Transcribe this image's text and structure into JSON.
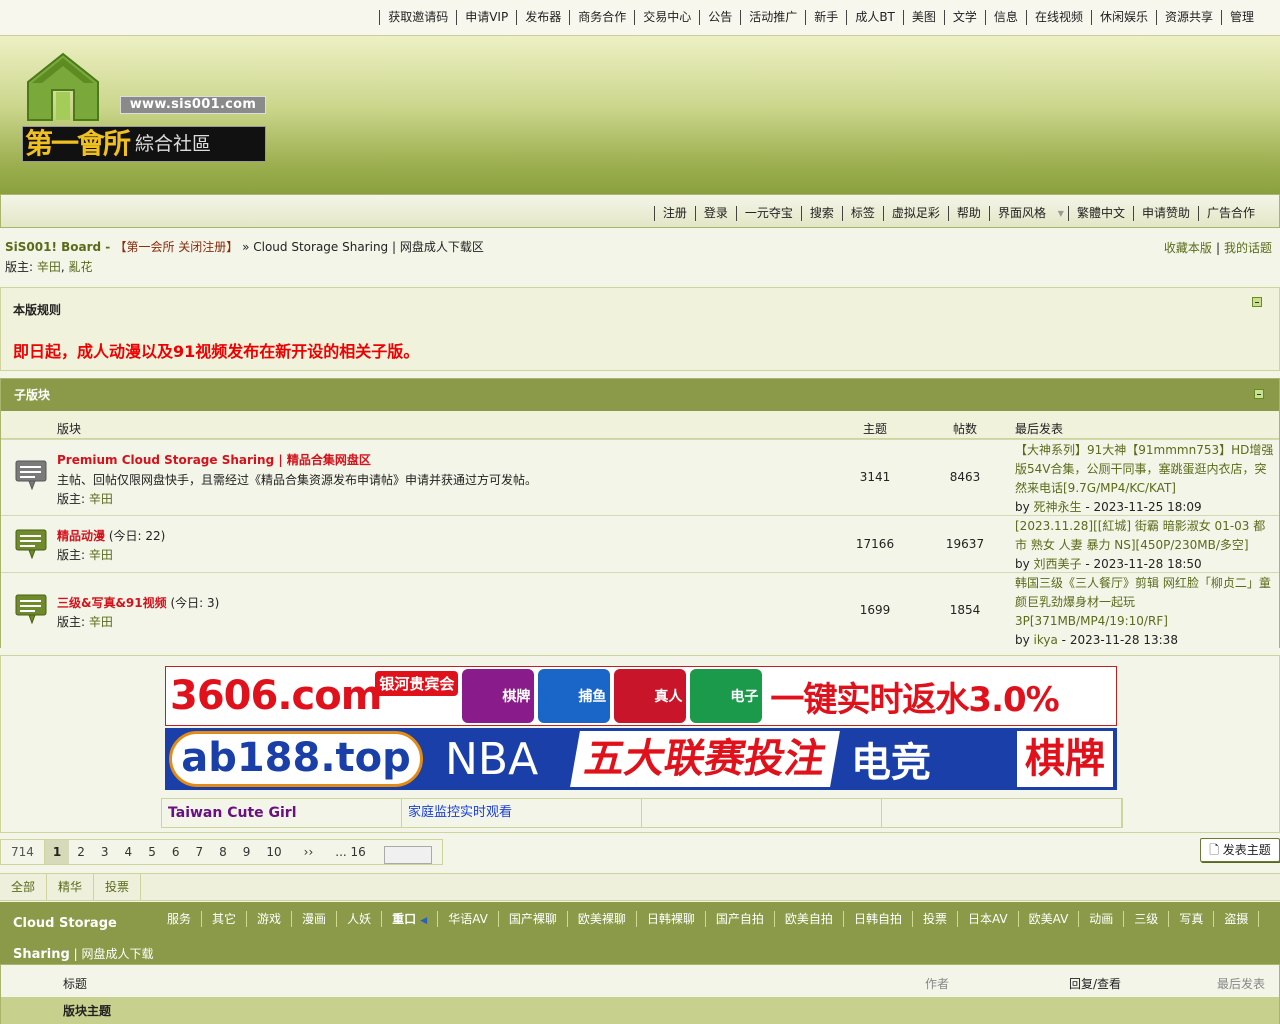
{
  "topbar": {
    "links": [
      "获取邀请码",
      "申请VIP",
      "发布器",
      "商务合作",
      "交易中心",
      "公告",
      "活动推广",
      "新手",
      "成人BT",
      "美图",
      "文学",
      "信息",
      "在线视频",
      "休闲娱乐",
      "资源共享",
      "管理"
    ]
  },
  "logo": {
    "url_text": "www.sis001.com",
    "big_text": "第一會所",
    "small_text": "綜合社區"
  },
  "nav": {
    "links": [
      "注册",
      "登录",
      "一元夺宝",
      "搜索",
      "标签",
      "虚拟足彩",
      "帮助",
      "界面风格",
      "繁體中文",
      "申请赞助",
      "广告合作"
    ]
  },
  "breadcrumb": {
    "site": "SiS001! Board",
    "sep1": " - ",
    "section": "【第一会所 关闭注册】",
    "sep2": " » ",
    "current": "Cloud Storage Sharing | 网盘成人下载区",
    "moderators_label": "版主: ",
    "moderators": [
      "辛田",
      "亂花"
    ],
    "favorite": "收藏本版",
    "my_threads": "我的话题"
  },
  "rules": {
    "title": "本版规则",
    "body": "即日起，成人动漫以及91视频发布在新开设的相关子版。"
  },
  "subforums": {
    "title": "子版块",
    "col_forum": "版块",
    "col_topics": "主题",
    "col_posts": "帖数",
    "col_last": "最后发表",
    "rows": [
      {
        "name": "Premium Cloud Storage Sharing | 精品合集网盘区",
        "today": "",
        "desc": "主帖、回帖仅限网盘快手，且需经过《精品合集资源发布申请帖》申请并获通过方可发帖。",
        "mod_label": "版主: ",
        "mod": "辛田",
        "topics": "3141",
        "posts": "8463",
        "last_title": "【大神系列】91大神【91mmmn753】HD增强版54V合集，公厕干同事，塞跳蛋逛内衣店，突然来电话[9.7G/MP4/KC/KAT]",
        "last_by": "by ",
        "last_author": "死神永生",
        "last_time": " - 2023-11-25 18:09"
      },
      {
        "name": "精品动漫",
        "today": " (今日: 22)",
        "desc": "",
        "mod_label": "版主: ",
        "mod": "辛田",
        "topics": "17166",
        "posts": "19637",
        "last_title": "[2023.11.28][[紅城] 街霸 暗影淑女 01-03 都市 熟女 人妻 暴力 NS][450P/230MB/多空]",
        "last_by": "by ",
        "last_author": "刘西美子",
        "last_time": " - 2023-11-28 18:50"
      },
      {
        "name": "三级&写真&91视频",
        "today": " (今日: 3)",
        "desc": "",
        "mod_label": "版主: ",
        "mod": "辛田",
        "topics": "1699",
        "posts": "1854",
        "last_title": "韩国三级《三人餐厅》剪辑 网红脸「柳贞二」童颜巨乳劲爆身材一起玩3P[371MB/MP4/19:10/RF]",
        "last_by": "by ",
        "last_author": "ikya",
        "last_time": " - 2023-11-28 13:38"
      }
    ]
  },
  "ads": {
    "banner1": {
      "domain": "3606.com",
      "badge": "银河贵宾会",
      "tiles": [
        "棋牌",
        "捕鱼",
        "真人",
        "电子"
      ],
      "slogan": "一键实时返水3.0%"
    },
    "banner2": {
      "domain": "ab188.top",
      "nba": "NBA",
      "leagues": "五大联赛投注",
      "esports": "电竞",
      "chess": "棋牌"
    },
    "links": [
      "Taiwan Cute Girl",
      "家庭监控实时观看",
      "",
      ""
    ]
  },
  "pagination": {
    "total": "714",
    "pages": [
      "1",
      "2",
      "3",
      "4",
      "5",
      "6",
      "7",
      "8",
      "9",
      "10"
    ],
    "current": "1",
    "next": "››",
    "last": "... 16",
    "new_post": "发表主题"
  },
  "filter": {
    "tabs": [
      "全部",
      "精华",
      "投票"
    ]
  },
  "typebar": {
    "name": "Cloud Storage Sharing",
    "name_sub": " | 网盘成人下载区",
    "types": [
      "服务",
      "其它",
      "游戏",
      "漫画",
      "人妖",
      "重口",
      "华语AV",
      "国产裸聊",
      "欧美裸聊",
      "日韩裸聊",
      "国产自拍",
      "欧美自拍",
      "日韩自拍",
      "投票",
      "日本AV",
      "欧美AV",
      "动画",
      "三级",
      "写真",
      "盗摄"
    ],
    "active": "重口"
  },
  "threadlist": {
    "col_title": "标题",
    "col_author": "作者",
    "col_replies": "回复/查看",
    "col_last": "最后发表",
    "section": "版块主题"
  },
  "colors": {
    "green_bar": "#8a9a48",
    "link_green": "#5a6b1a",
    "forum_red": "#d4121c",
    "rule_red": "#e00"
  }
}
